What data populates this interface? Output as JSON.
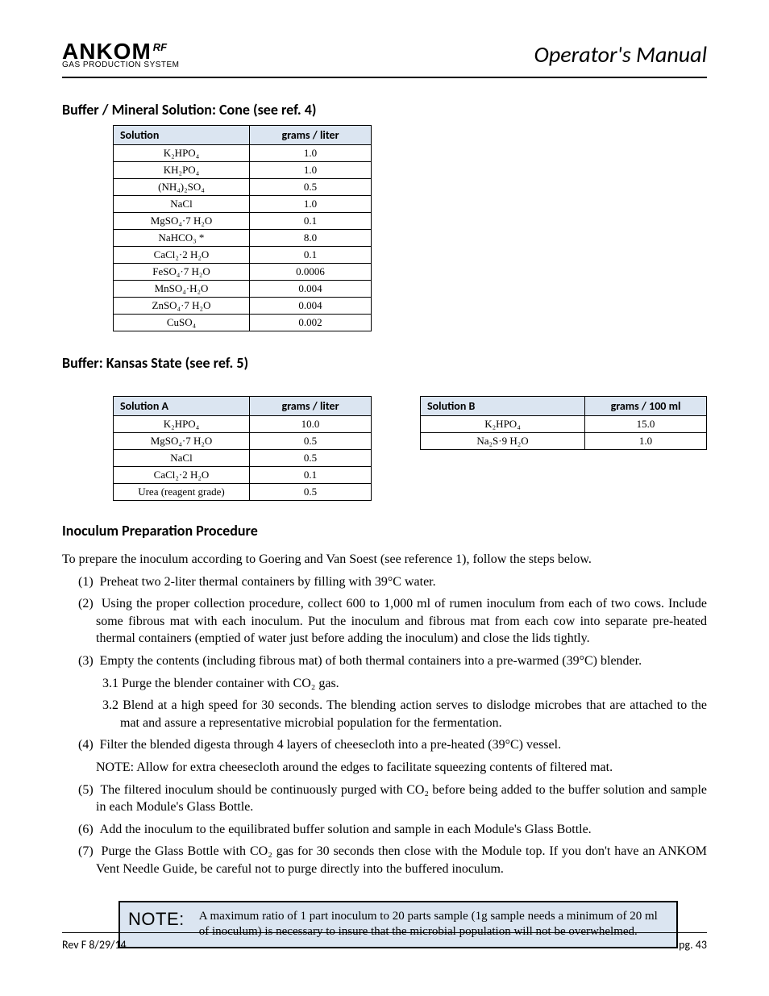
{
  "header": {
    "logo_main": "ANKOM",
    "logo_rf": "RF",
    "logo_sub": "GAS PRODUCTION SYSTEM",
    "title": "Operator's Manual"
  },
  "sections": {
    "cone_heading": "Buffer / Mineral Solution: Cone (see ref. 4)",
    "cone_table": {
      "h1": "Solution",
      "h2": "grams / liter",
      "rows": [
        [
          "K₂HPO₄",
          "1.0"
        ],
        [
          "KH₂PO₄",
          "1.0"
        ],
        [
          "(NH₄)₂SO₄",
          "0.5"
        ],
        [
          "NaCl",
          "1.0"
        ],
        [
          "MgSO₄·7 H₂O",
          "0.1"
        ],
        [
          "NaHCO₃ *",
          "8.0"
        ],
        [
          "CaCl₂·2 H₂O",
          "0.1"
        ],
        [
          "FeSO₄·7 H₂O",
          "0.0006"
        ],
        [
          "MnSO₄·H₂O",
          "0.004"
        ],
        [
          "ZnSO₄·7 H₂O",
          "0.004"
        ],
        [
          "CuSO₄",
          "0.002"
        ]
      ]
    },
    "kansas_heading": "Buffer: Kansas State (see ref. 5)",
    "kansas_a": {
      "h1": "Solution A",
      "h2": "grams / liter",
      "rows": [
        [
          "K₂HPO₄",
          "10.0"
        ],
        [
          "MgSO₄·7 H₂O",
          "0.5"
        ],
        [
          "NaCl",
          "0.5"
        ],
        [
          "CaCl₂·2 H₂O",
          "0.1"
        ],
        [
          "Urea (reagent grade)",
          "0.5"
        ]
      ]
    },
    "kansas_b": {
      "h1": "Solution B",
      "h2": "grams / 100 ml",
      "rows": [
        [
          "K₂HPO₄",
          "15.0"
        ],
        [
          "Na₂S·9 H₂O",
          "1.0"
        ]
      ]
    },
    "inoc_heading": "Inoculum Preparation Procedure"
  },
  "paragraphs": {
    "p1": "To prepare the inoculum according to Goering and Van Soest (see reference 1), follow the steps below.",
    "p2_num": "(1)",
    "p2": "Preheat two 2-liter thermal containers by filling with 39°C water.",
    "p3_num": "(2)",
    "p3": "Using the proper collection procedure, collect 600 to 1,000 ml of rumen inoculum from each of two cows. Include some fibrous mat with each inoculum. Put the inoculum and fibrous mat from each cow into separate pre-heated thermal containers (emptied of water just before adding the inoculum) and close the lids tightly.",
    "p4a_num": "(3)",
    "p4a": "Empty the contents (including fibrous mat) of both thermal containers into a pre-warmed (39°C) blender.",
    "p4b": "3.1  Purge the blender container with CO₂ gas.",
    "p4c": "3.2  Blend at a high speed for 30 seconds. The blending action serves to dislodge microbes that are attached to the mat and assure a representative microbial population for the fermentation.",
    "p5_num": "(4)",
    "p5": "Filter the blended digesta through 4 layers of cheesecloth into a pre-heated (39°C) vessel.",
    "note_after_p5": "NOTE: Allow for extra cheesecloth around the edges to facilitate squeezing contents of filtered mat.",
    "p6_num": "(5)",
    "p6": "The filtered inoculum should be continuously purged with CO₂ before being added to the buffer solution and sample in each Module's Glass Bottle.",
    "p7_num": "(6)",
    "p7": "Add the inoculum to the equilibrated buffer solution and sample in each Module's Glass Bottle.",
    "p8_num": "(7)",
    "p8": "Purge the Glass Bottle with CO₂ gas for 30 seconds then close with the Module top. If you don't have an ANKOM Vent Needle Guide, be careful not to purge directly into the buffered inoculum."
  },
  "note_box": {
    "label": "NOTE:",
    "text": "A maximum ratio of 1 part inoculum to 20 parts sample (1g sample needs a minimum of 20 ml of inoculum) is necessary to insure that the microbial population will not be overwhelmed."
  },
  "footer": {
    "left": "Rev F 8/29/14",
    "right": "pg. 43"
  }
}
